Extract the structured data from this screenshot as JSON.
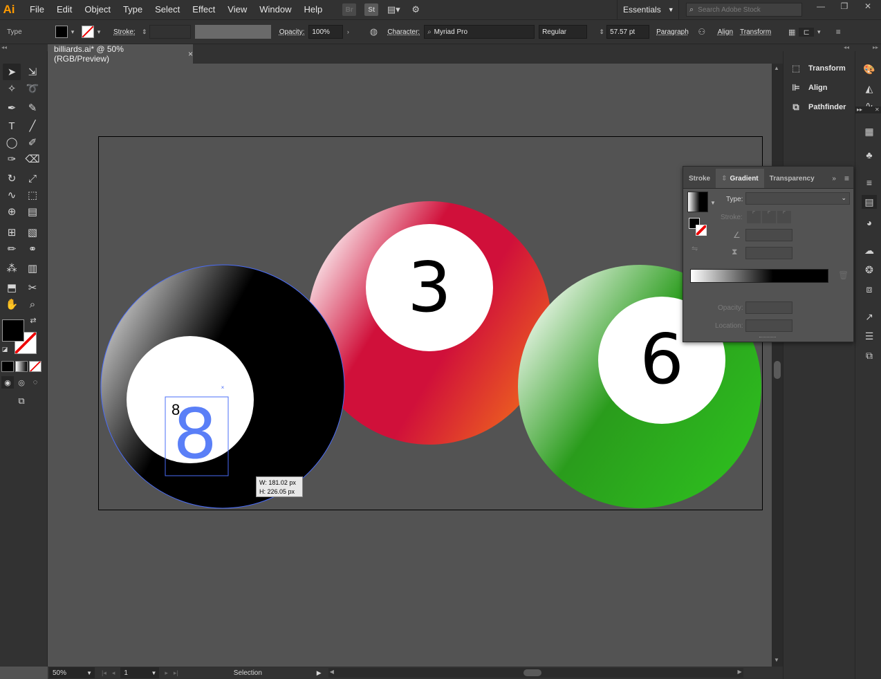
{
  "app": {
    "logo": "Ai"
  },
  "menu": [
    "File",
    "Edit",
    "Object",
    "Type",
    "Select",
    "Effect",
    "View",
    "Window",
    "Help"
  ],
  "menu_icons": {
    "bridge": "Br",
    "stock": "St"
  },
  "workspace": {
    "label": "Essentials"
  },
  "search": {
    "placeholder": "Search Adobe Stock"
  },
  "control_bar": {
    "selection_type": "Type",
    "stroke_label": "Stroke:",
    "opacity_label": "Opacity:",
    "opacity_value": "100%",
    "character_label": "Character:",
    "font_family": "Myriad Pro",
    "font_style": "Regular",
    "font_size": "57.57 pt",
    "paragraph_label": "Paragraph",
    "align_label": "Align",
    "transform_label": "Transform"
  },
  "document_tab": {
    "title": "billiards.ai* @ 50% (RGB/Preview)",
    "close": "×"
  },
  "artboard": {
    "balls": [
      {
        "number": "8",
        "color": "#000000"
      },
      {
        "number": "3",
        "color": "#d0103a"
      },
      {
        "number": "6",
        "color": "#2ec01f"
      }
    ],
    "selection_text": "8",
    "dimension_tooltip": {
      "width": "W: 181.02 px",
      "height": "H: 226.05 px"
    }
  },
  "status_bar": {
    "zoom": "50%",
    "page": "1",
    "tool": "Selection"
  },
  "dock_panels": [
    "Transform",
    "Align",
    "Pathfinder"
  ],
  "gradient_panel": {
    "tabs": [
      "Stroke",
      "Gradient",
      "Transparency"
    ],
    "active_tab": "Gradient",
    "type_label": "Type:",
    "stroke_label": "Stroke:",
    "opacity_label": "Opacity:",
    "location_label": "Location:"
  },
  "colors": {
    "accent": "#ff9a00",
    "selection": "#4a6cf7"
  }
}
